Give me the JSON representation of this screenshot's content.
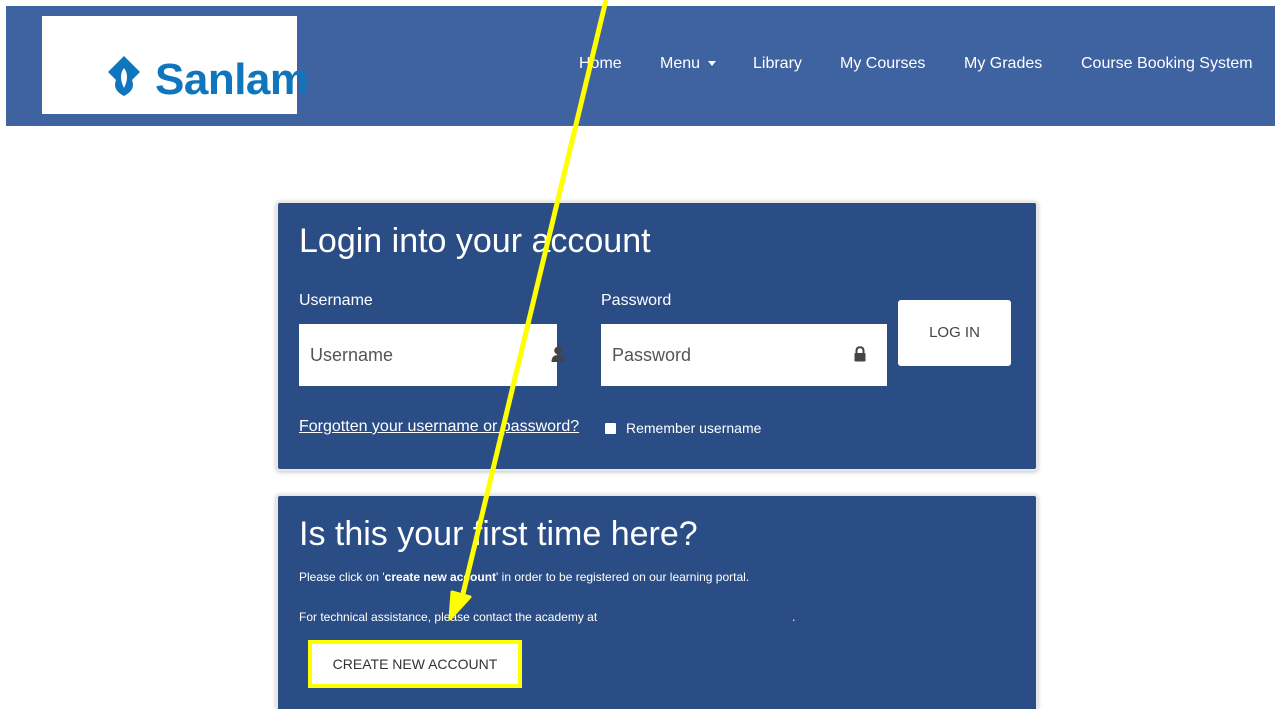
{
  "brand": {
    "name": "Sanlam",
    "color": "#0f75bc"
  },
  "nav": {
    "items": [
      {
        "label": "Home"
      },
      {
        "label": "Menu"
      },
      {
        "label": "Library"
      },
      {
        "label": "My Courses"
      },
      {
        "label": "My Grades"
      },
      {
        "label": "Course Booking System"
      }
    ]
  },
  "login": {
    "title": "Login into your account",
    "username_label": "Username",
    "username_placeholder": "Username",
    "username_value": "",
    "password_label": "Password",
    "password_placeholder": "Password",
    "password_value": "",
    "login_button": "LOG IN",
    "forgot_link": "Forgotten your username or password?",
    "remember_label": "Remember username",
    "remember_checked": false
  },
  "first_time": {
    "title": "Is this your first time here?",
    "line1_prefix": "Please click on '",
    "line1_bold": "create new account",
    "line1_suffix": "' in order to be registered on our learning portal.",
    "line2": "For technical assistance, please contact the academy at",
    "line2_end": ".",
    "create_button": "CREATE NEW ACCOUNT"
  },
  "colors": {
    "navbar": "#3f62a0",
    "panel": "#2b4d85",
    "highlight": "#ffff00"
  },
  "icons": [
    "brand-logo-icon",
    "user-icon",
    "lock-icon",
    "caret-down-icon",
    "annotation-arrow-icon"
  ]
}
